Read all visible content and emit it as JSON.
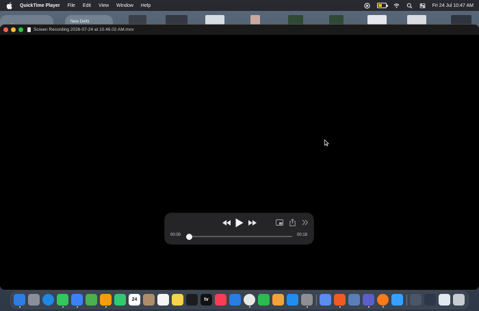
{
  "menubar": {
    "app_name": "QuickTime Player",
    "items": [
      "File",
      "Edit",
      "View",
      "Window",
      "Help"
    ],
    "clock": "Fri 24 Jul  10:47 AM",
    "battery_level": 0.55
  },
  "desktop": {
    "widget_city": "New Delhi",
    "widget_other": "..."
  },
  "window": {
    "title": "Screen Recording 2026-07-24 at 10.46.02 AM.mov"
  },
  "player": {
    "current_time": "00:00",
    "duration": "00:19",
    "progress": 0.0
  },
  "dock": {
    "calendar_day": "24",
    "tv_label": "tv",
    "items": [
      {
        "name": "finder",
        "color": "#2f7de1"
      },
      {
        "name": "launchpad",
        "color": "#8a8f9a"
      },
      {
        "name": "safari",
        "color": "#1e88e5"
      },
      {
        "name": "messages",
        "color": "#34c759"
      },
      {
        "name": "mail",
        "color": "#3b82f6"
      },
      {
        "name": "maps",
        "color": "#4caf50"
      },
      {
        "name": "photos",
        "color": "#f59e0b"
      },
      {
        "name": "facetime",
        "color": "#2ecc71"
      },
      {
        "name": "calendar",
        "color": "#ffffff"
      },
      {
        "name": "contacts",
        "color": "#b08d6a"
      },
      {
        "name": "reminders",
        "color": "#f5f5f5"
      },
      {
        "name": "notes",
        "color": "#f7d24a"
      },
      {
        "name": "stocks",
        "color": "#1c1c1e"
      },
      {
        "name": "apple-tv",
        "color": "#111111"
      },
      {
        "name": "music",
        "color": "#fa3c55"
      },
      {
        "name": "keynote",
        "color": "#2a7de1"
      },
      {
        "name": "chrome",
        "color": "#e8e8e8"
      },
      {
        "name": "numbers",
        "color": "#2dbb4d"
      },
      {
        "name": "pages",
        "color": "#f2a23a"
      },
      {
        "name": "app-store",
        "color": "#1f8ef1"
      },
      {
        "name": "system-settings",
        "color": "#8e8e93"
      },
      {
        "name": "xcode",
        "color": "#5b8def"
      },
      {
        "name": "brave",
        "color": "#f05a24"
      },
      {
        "name": "gemini",
        "color": "#5a7fb8"
      },
      {
        "name": "teams",
        "color": "#5b5fc7"
      },
      {
        "name": "firefox",
        "color": "#ff7a1a"
      },
      {
        "name": "quickq",
        "color": "#3aa0ff"
      },
      {
        "name": "window-thumb-1",
        "color": "#4a5568"
      },
      {
        "name": "window-thumb-2",
        "color": "#2d3748"
      },
      {
        "name": "window-thumb-3",
        "color": "#e2e8f0"
      },
      {
        "name": "trash",
        "color": "#c8ccd2"
      }
    ]
  }
}
